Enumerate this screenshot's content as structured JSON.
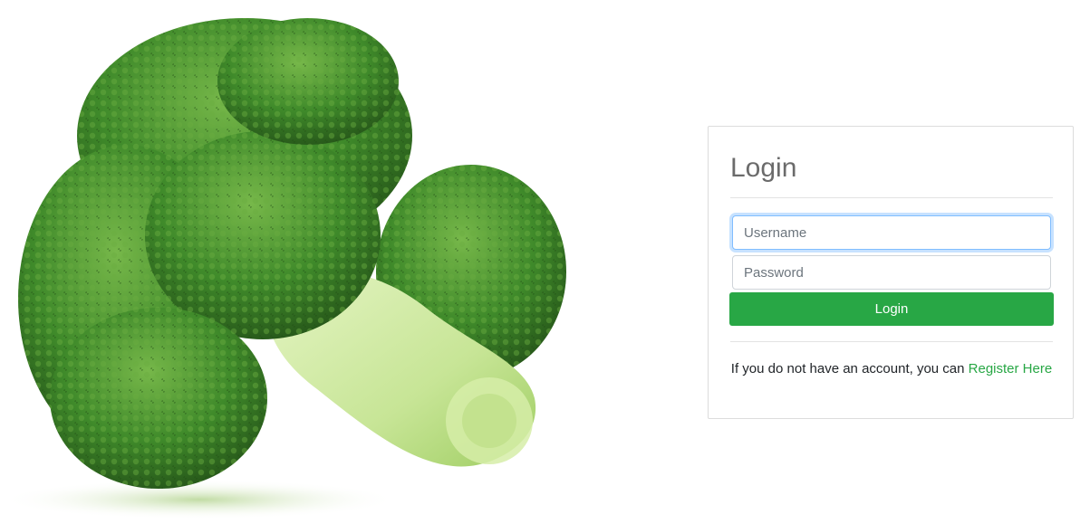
{
  "login": {
    "title": "Login",
    "username_placeholder": "Username",
    "password_placeholder": "Password",
    "button_label": "Login",
    "register_prompt": "If you do not have an account, you can",
    "register_link": "Register Here"
  },
  "colors": {
    "accent": "#28a745",
    "focus": "#80bdff",
    "broccoli_dark": "#2f6b1f",
    "broccoli_light": "#5fa33a",
    "stem": "#c9e79a"
  },
  "hero": {
    "image": "broccoli-image"
  }
}
